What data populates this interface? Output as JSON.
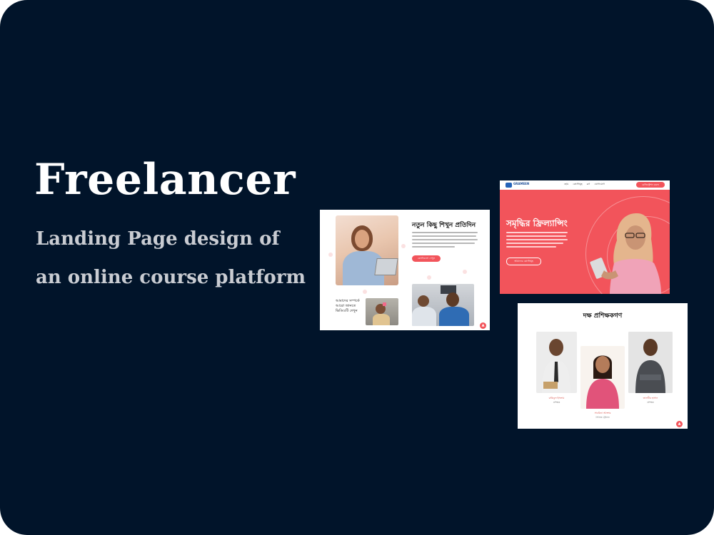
{
  "hero": {
    "title": "Freelancer",
    "subtitle": "Landing Page design of an online course platform"
  },
  "card_learn": {
    "heading": "নতুন কিছু শিখুন প্রতিদিন",
    "button_label": "কোর্সগুলো দেখুন",
    "side_text": "আমাদের সম্পর্কে আরো জানতে ভিডিওটি দেখুন"
  },
  "card_hero_page": {
    "logo_text": "GRAMEEN",
    "menu_items": [
      "হোম",
      "কোর্সসমূহ",
      "ব্লগ",
      "যোগাযোগ"
    ],
    "nav_button_label": "রেজিস্ট্রেশন করুন",
    "heading": "সমৃদ্ধির ফ্রিল্যান্সিং",
    "button_label": "আমাদের কোর্সসমূহ"
  },
  "card_trainers": {
    "heading": "দক্ষ প্রশিক্ষকগণ",
    "trainers": [
      {
        "name": "রাকিবুল ইসলাম",
        "role": "প্রশিক্ষক"
      },
      {
        "name": "সাবরিনা আক্তার",
        "role": "সিনিয়র ট্রেইনার"
      },
      {
        "name": "তানভীর হাসান",
        "role": "প্রশিক্ষক"
      }
    ]
  },
  "colors": {
    "background": "#01142a",
    "accent": "#f2545b",
    "title": "#ffffff",
    "subtitle": "#c9ccd2"
  },
  "icons": {
    "fab": "arrow-up-icon"
  }
}
